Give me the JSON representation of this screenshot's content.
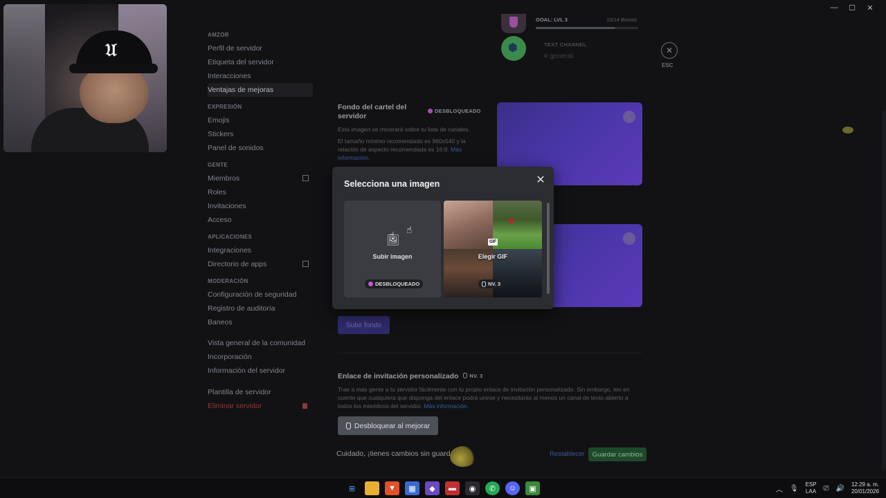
{
  "window": {
    "minimize": "—",
    "maximize": "☐",
    "close": "✕"
  },
  "sidebar": {
    "sections": [
      {
        "header": "AMZOR",
        "items": [
          "Perfil de servidor",
          "Etiqueta del servidor",
          "Interacciones",
          "Ventajas de mejoras"
        ]
      },
      {
        "header": "EXPRESIÓN",
        "items": [
          "Emojis",
          "Stickers",
          "Panel de sonidos"
        ]
      },
      {
        "header": "GENTE",
        "items": [
          "Miembros",
          "Roles",
          "Invitaciones",
          "Acceso"
        ]
      },
      {
        "header": "APLICACIONES",
        "items": [
          "Integraciones",
          "Directorio de apps"
        ]
      },
      {
        "header": "MODERACIÓN",
        "items": [
          "Configuración de seguridad",
          "Registro de auditoría",
          "Baneos"
        ]
      },
      {
        "header": "",
        "items": [
          "Vista general de la comunidad",
          "Incorporación",
          "Información del servidor"
        ]
      },
      {
        "header": "",
        "items": [
          "Plantilla de servidor",
          "Eliminar servidor"
        ]
      }
    ]
  },
  "top_card": {
    "goal_label": "GOAL: LVL 3",
    "goal_count": "10/14 Boosts",
    "goal_progress": 0.78,
    "text_channel_label": "TEXT CHANNEL",
    "channel_name": "# general"
  },
  "esc": {
    "icon": "✕",
    "label": "ESC"
  },
  "banner_section": {
    "title": "Fondo del cartel del servidor",
    "badge": "DESBLOQUEADO",
    "desc1": "Esta imagen se mostrará sobre tu lista de canales.",
    "desc2": "El tamaño mínimo recomendado es 960x540 y la relación de aspecto recomendada es 16:9.",
    "more_info": "Más información.",
    "upload_button": "Subir fondo"
  },
  "invite_section": {
    "title": "Enlace de invitación personalizado",
    "badge": "NV. 3",
    "desc": "Trae a más gente a tu servidor fácilmente con tu propio enlace de invitación personalizado. Sin embargo, ten en cuente que cualquiera que disponga del enlace podrá unirse y necesitarás al menos un canal de texto abierto a todos los miembros del servidor.",
    "more_info": "Más información.",
    "unlock_button": "Desbloquear al mejorar"
  },
  "unsaved_bar": {
    "text": "Cuidado, ¡tienes cambios sin guardar!",
    "reset": "Restablecer",
    "save": "Guardar cambios"
  },
  "modal": {
    "title": "Selecciona una imagen",
    "close_icon": "✕",
    "upload_label": "Subir imagen",
    "upload_badge": "DESBLOQUEADO",
    "gif_tag": "GIF",
    "gif_label": "Elegir GIF",
    "gif_badge": "NV. 3"
  },
  "taskbar": {
    "tray_lang_1": "ESP",
    "tray_lang_2": "LAA",
    "time": "12:29 a. m.",
    "date": "20/01/2026"
  },
  "colors": {
    "accent": "#5865f2",
    "boost_pink": "#c05ad0",
    "save_green": "#1e4a2a"
  }
}
